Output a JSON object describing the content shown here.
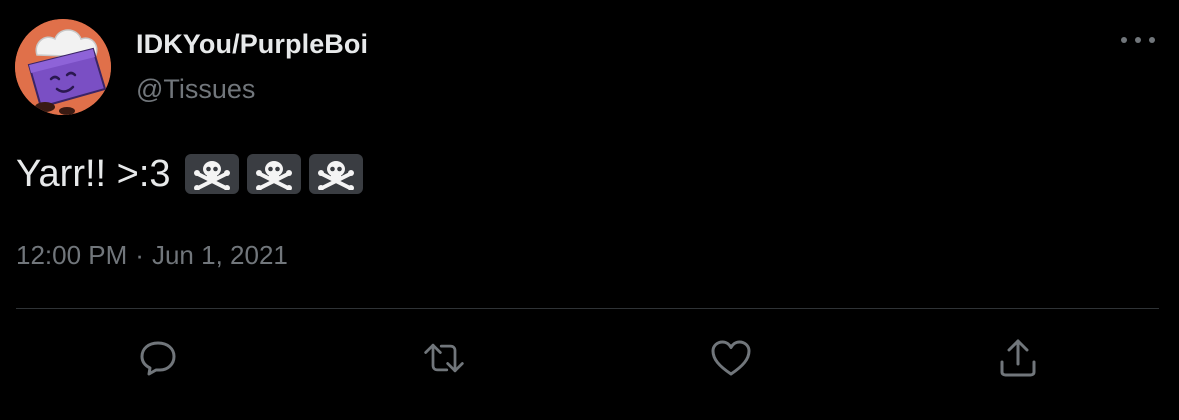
{
  "user": {
    "display_name": "IDKYou/PurpleBoi",
    "handle": "@Tissues",
    "avatar_icon": "purple-tissue-box-avatar"
  },
  "tweet": {
    "text": "Yarr!! >:3",
    "emojis": [
      "skull-and-crossbones-emoji",
      "skull-and-crossbones-emoji",
      "skull-and-crossbones-emoji"
    ],
    "time": "12:00 PM",
    "separator": "·",
    "date": "Jun 1, 2021"
  },
  "actions": [
    {
      "name": "reply",
      "icon": "reply-icon"
    },
    {
      "name": "retweet",
      "icon": "retweet-icon"
    },
    {
      "name": "like",
      "icon": "heart-icon"
    },
    {
      "name": "share",
      "icon": "share-icon"
    }
  ],
  "colors": {
    "background": "#000000",
    "primary_text": "#e7e9ea",
    "secondary_text": "#71767b",
    "divider": "#2f3336",
    "icon": "#71767b",
    "avatar_bg": "#e0704a",
    "avatar_box": "#7a4fc4"
  }
}
